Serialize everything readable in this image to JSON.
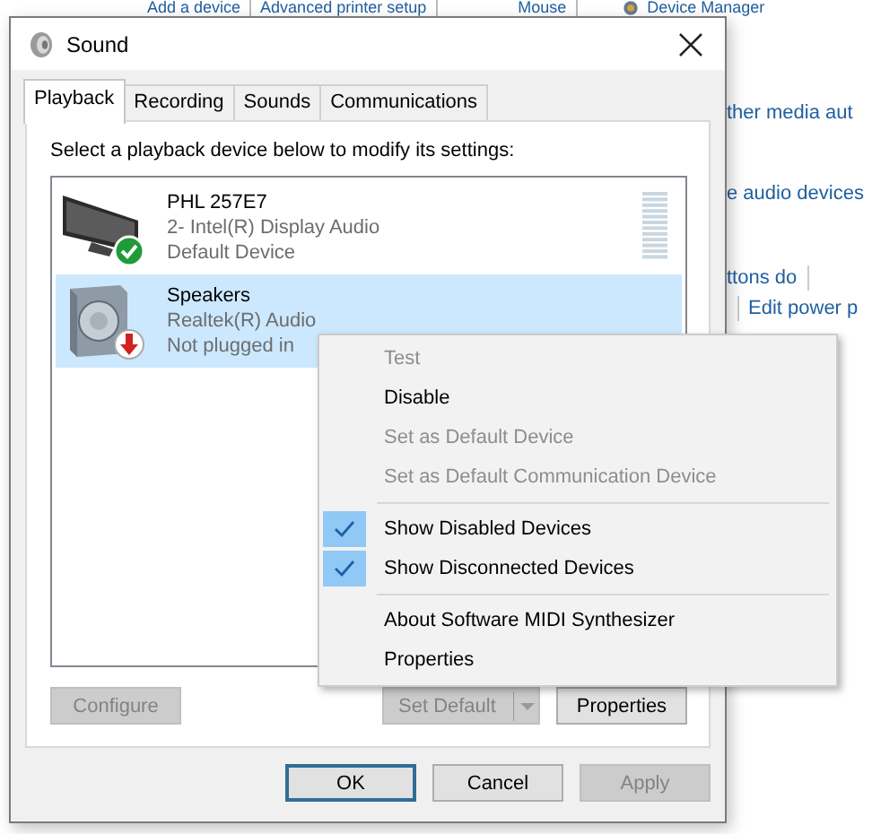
{
  "background": {
    "top_links": [
      "Add a device",
      "Advanced printer setup",
      "Mouse",
      "Device Manager"
    ],
    "side_links": [
      {
        "label": "ther media aut",
        "kind": "plain"
      },
      {
        "label": "e audio devices",
        "kind": "plain"
      },
      {
        "label": "ttons do",
        "kind": "plain"
      },
      {
        "label": "Edit power p",
        "kind": "indented"
      }
    ]
  },
  "dialog": {
    "title": "Sound",
    "tabs": [
      {
        "label": "Playback",
        "selected": true
      },
      {
        "label": "Recording",
        "selected": false
      },
      {
        "label": "Sounds",
        "selected": false
      },
      {
        "label": "Communications",
        "selected": false
      }
    ],
    "instruction": "Select a playback device below to modify its settings:",
    "devices": [
      {
        "kind": "monitor",
        "connected": true,
        "name": "PHL 257E7",
        "driver": "2- Intel(R) Display Audio",
        "status": "Default Device",
        "selected": false
      },
      {
        "kind": "speaker",
        "connected": false,
        "name": "Speakers",
        "driver": "Realtek(R) Audio",
        "status": "Not plugged in",
        "selected": true
      }
    ],
    "device_buttons": [
      {
        "label": "Configure",
        "kind": "button",
        "disabled": true
      },
      {
        "label": "Set Default",
        "kind": "split",
        "disabled": true
      },
      {
        "label": "Properties",
        "kind": "button",
        "disabled": false
      }
    ],
    "buttons": [
      {
        "label": "OK",
        "disabled": false,
        "default": true
      },
      {
        "label": "Cancel",
        "disabled": false,
        "default": false
      },
      {
        "label": "Apply",
        "disabled": true,
        "default": false
      }
    ]
  },
  "context_menu": {
    "groups": [
      [
        {
          "label": "Test",
          "disabled": true,
          "checked": false
        },
        {
          "label": "Disable",
          "disabled": false,
          "checked": false
        },
        {
          "label": "Set as Default Device",
          "disabled": true,
          "checked": false
        },
        {
          "label": "Set as Default Communication Device",
          "disabled": true,
          "checked": false
        }
      ],
      [
        {
          "label": "Show Disabled Devices",
          "disabled": false,
          "checked": true
        },
        {
          "label": "Show Disconnected Devices",
          "disabled": false,
          "checked": true
        }
      ],
      [
        {
          "label": "About Software MIDI Synthesizer",
          "disabled": false,
          "checked": false
        },
        {
          "label": "Properties",
          "disabled": false,
          "checked": false
        }
      ]
    ]
  }
}
